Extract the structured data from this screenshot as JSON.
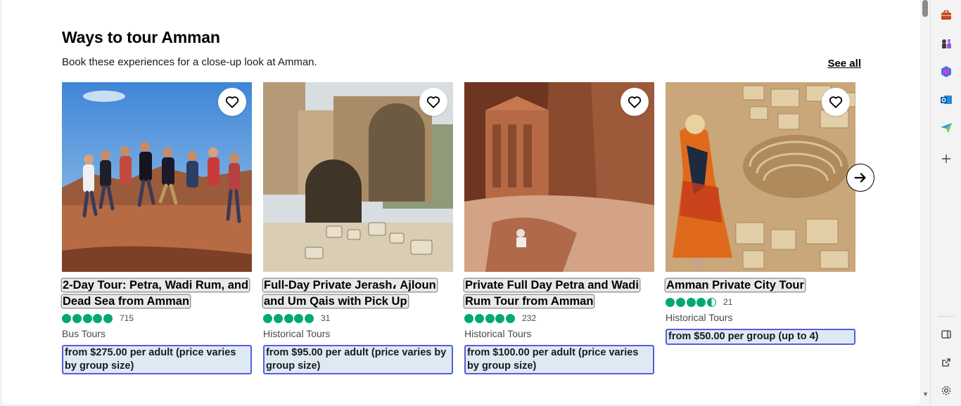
{
  "section": {
    "title": "Ways to tour Amman",
    "subtitle": "Book these experiences for a close-up look at Amman.",
    "see_all": "See all"
  },
  "cards": [
    {
      "title": "2-Day Tour: Petra, Wadi Rum, and Dead Sea from Amman",
      "rating": 5,
      "reviews": "715",
      "category": "Bus Tours",
      "price": "from $275.00 per adult (price varies by group size)",
      "image": "group-jumping-desert-photo"
    },
    {
      "title": "Full-Day Private Jerash، Ajloun and Um Qais with Pick Up",
      "rating": 5,
      "reviews": "31",
      "category": "Historical Tours",
      "price": "from $95.00 per adult (price varies by group size)",
      "image": "stone-ruins-photo"
    },
    {
      "title": "Private Full Day Petra and Wadi Rum Tour from Amman",
      "rating": 5,
      "reviews": "232",
      "category": "Historical Tours",
      "price": "from $100.00 per adult (price varies by group size)",
      "image": "petra-treasury-photo"
    },
    {
      "title": "Amman Private City Tour",
      "rating": 4.5,
      "reviews": "21",
      "category": "Historical Tours",
      "price": "from $50.00 per group (up to 4)",
      "image": "amman-city-view-photo"
    }
  ],
  "icons": {
    "favorite": "heart-icon",
    "next": "arrow-right-icon",
    "sidebar": [
      "briefcase-icon",
      "chess-icon",
      "copilot-icon",
      "outlook-icon",
      "send-icon",
      "plus-icon",
      "split-screen-icon",
      "external-link-icon",
      "settings-icon"
    ]
  },
  "colors": {
    "rating_bubble": "#00aa6c",
    "price_border": "#5b5bdb",
    "price_bg": "#ddeaf4"
  }
}
